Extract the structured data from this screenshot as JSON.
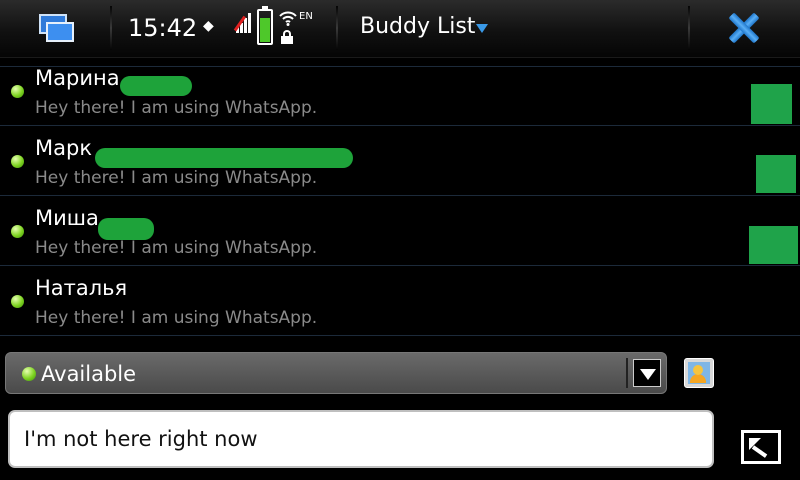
{
  "status_bar": {
    "time": "15:42",
    "language": "EN",
    "title": "Buddy List",
    "icons": {
      "task_switcher": "task-switcher-icon",
      "presence": "presence-icon",
      "signal": "no-signal-icon",
      "battery": "battery-icon",
      "wifi": "wifi-icon",
      "lock": "lock-icon",
      "close": "close-icon"
    }
  },
  "contacts": [
    {
      "name": "Марина",
      "status": "Hey there! I am using WhatsApp.",
      "online": true
    },
    {
      "name": "Марк",
      "status": "Hey there! I am using WhatsApp.",
      "online": true
    },
    {
      "name": "Миша",
      "status": "Hey there! I am using WhatsApp.",
      "online": true
    },
    {
      "name": "Наталья",
      "status": "Hey there! I am using WhatsApp.",
      "online": true
    }
  ],
  "presence": {
    "selected": "Available"
  },
  "status_message": {
    "value": "I'm not here right now"
  },
  "colors": {
    "accent": "#3a9ae8",
    "online": "#7ed321",
    "redaction": "#1ea33a",
    "secondary_text": "#8a8a8a"
  }
}
